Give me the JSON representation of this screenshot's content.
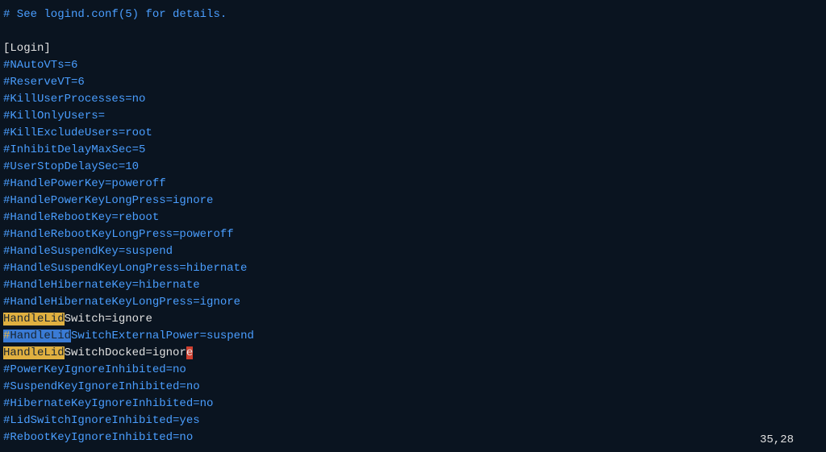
{
  "lines": {
    "l1": "# See logind.conf(5) for details.",
    "l2": "",
    "l3": "[Login]",
    "l4": "#NAutoVTs=6",
    "l5": "#ReserveVT=6",
    "l6": "#KillUserProcesses=no",
    "l7": "#KillOnlyUsers=",
    "l8": "#KillExcludeUsers=root",
    "l9": "#InhibitDelayMaxSec=5",
    "l10": "#UserStopDelaySec=10",
    "l11": "#HandlePowerKey=poweroff",
    "l12": "#HandlePowerKeyLongPress=ignore",
    "l13": "#HandleRebootKey=reboot",
    "l14": "#HandleRebootKeyLongPress=poweroff",
    "l15": "#HandleSuspendKey=suspend",
    "l16": "#HandleSuspendKeyLongPress=hibernate",
    "l17": "#HandleHibernateKey=hibernate",
    "l18": "#HandleHibernateKeyLongPress=ignore",
    "l19_hl": "HandleLid",
    "l19_rest": "Switch=ignore",
    "l20_hash": "#",
    "l20_hl": "HandleLid",
    "l20_rest": "SwitchExternalPower=suspend",
    "l21_hl": "HandleLid",
    "l21_mid": "SwitchDocked=ignor",
    "l21_cursor": "e",
    "l22": "#PowerKeyIgnoreInhibited=no",
    "l23": "#SuspendKeyIgnoreInhibited=no",
    "l24": "#HibernateKeyIgnoreInhibited=no",
    "l25": "#LidSwitchIgnoreInhibited=yes",
    "l26": "#RebootKeyIgnoreInhibited=no"
  },
  "status": "35,28"
}
